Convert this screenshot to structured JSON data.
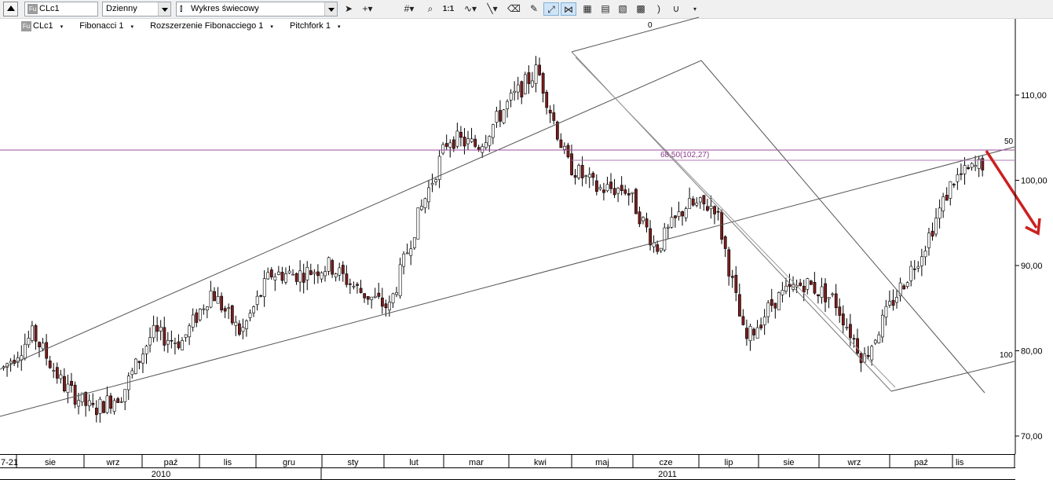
{
  "toolbar": {
    "symbol": "CLc1",
    "symbol_badge": "Fu",
    "interval": "Dzienny",
    "chart_type": "Wykres świecowy",
    "zoom_label": "1:1"
  },
  "legend": {
    "symbol": "CLc1",
    "badge": "Fu",
    "items": [
      "Fibonacci 1",
      "Rozszerzenie Fibonacciego 1",
      "Pitchfork 1"
    ]
  },
  "chart_data": {
    "type": "candlestick",
    "y_ticks": [
      "110,00",
      "100,00",
      "90,00",
      "80,00",
      "70,00"
    ],
    "y_tick_values": [
      110,
      100,
      90,
      80,
      70
    ],
    "months": [
      "7-21",
      "sie",
      "wrz",
      "paź",
      "lis",
      "gru",
      "sty",
      "lut",
      "mar",
      "kwi",
      "maj",
      "cze",
      "lip",
      "sie",
      "wrz",
      "paź",
      "lis"
    ],
    "years": [
      "2010",
      "2011"
    ],
    "fib_labels": [
      "0",
      "50",
      "100"
    ],
    "level_label": "68,50(102,27)",
    "horizontal_level": 102.27,
    "price_path": [
      [
        "7-21",
        78
      ],
      [
        "sie",
        82
      ],
      [
        "sie",
        76
      ],
      [
        "wrz",
        73
      ],
      [
        "wrz",
        75
      ],
      [
        "paź",
        82
      ],
      [
        "paź",
        81
      ],
      [
        "lis",
        87
      ],
      [
        "lis",
        82
      ],
      [
        "gru",
        89
      ],
      [
        "gru",
        89
      ],
      [
        "sty",
        90
      ],
      [
        "sty",
        87
      ],
      [
        "lut",
        85
      ],
      [
        "lut",
        96
      ],
      [
        "mar",
        105
      ],
      [
        "mar",
        104
      ],
      [
        "kwi",
        109
      ],
      [
        "kwi",
        113
      ],
      [
        "maj",
        102
      ],
      [
        "maj",
        99
      ],
      [
        "cze",
        99
      ],
      [
        "cze",
        92
      ],
      [
        "lip",
        97
      ],
      [
        "lip",
        97
      ],
      [
        "sie",
        81
      ],
      [
        "sie",
        86
      ],
      [
        "wrz",
        88
      ],
      [
        "wrz",
        86
      ],
      [
        "paź",
        79
      ],
      [
        "paź",
        86
      ],
      [
        "lis",
        92
      ],
      [
        "lis",
        100
      ],
      [
        "lis",
        102
      ]
    ],
    "colors": {
      "up": "#ffffff",
      "down": "#7a1c1c",
      "level": "#9b4c9b",
      "arrow": "#cc1f1f"
    }
  }
}
